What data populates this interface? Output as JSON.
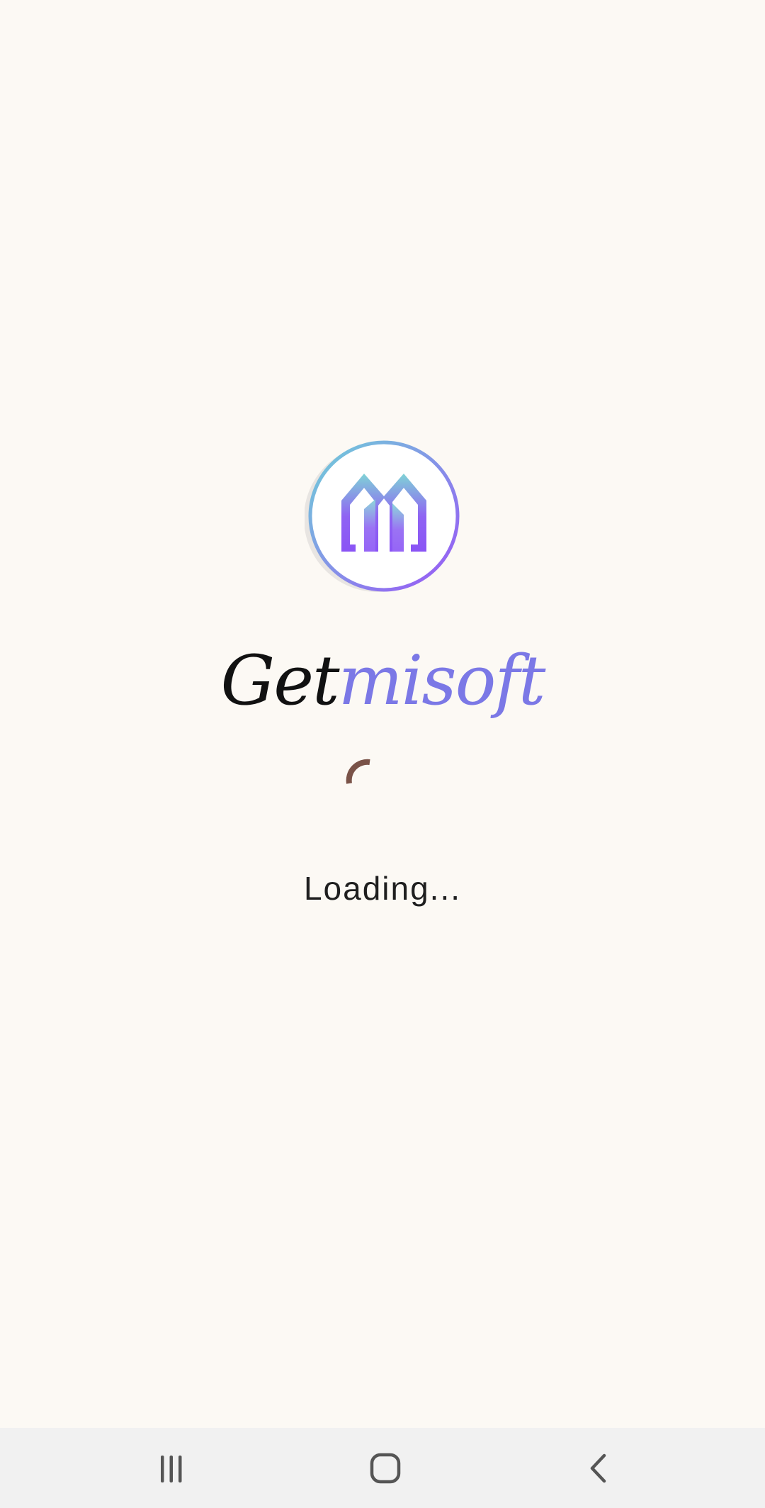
{
  "app": {
    "brand_part_a": "Get",
    "brand_part_b": "misoft",
    "loading_label": "Loading..."
  },
  "colors": {
    "background": "#fcf9f4",
    "brand_accent": "#7b78e6",
    "spinner": "#7a5348",
    "logo_gradient_top": "#7fd3d6",
    "logo_gradient_bottom": "#8a54f5",
    "navbar": "#f1f1f1"
  },
  "icons": {
    "logo": "house-m-logo-icon",
    "spinner": "loading-spinner-icon",
    "recents": "recents-icon",
    "home": "home-icon",
    "back": "back-icon"
  }
}
